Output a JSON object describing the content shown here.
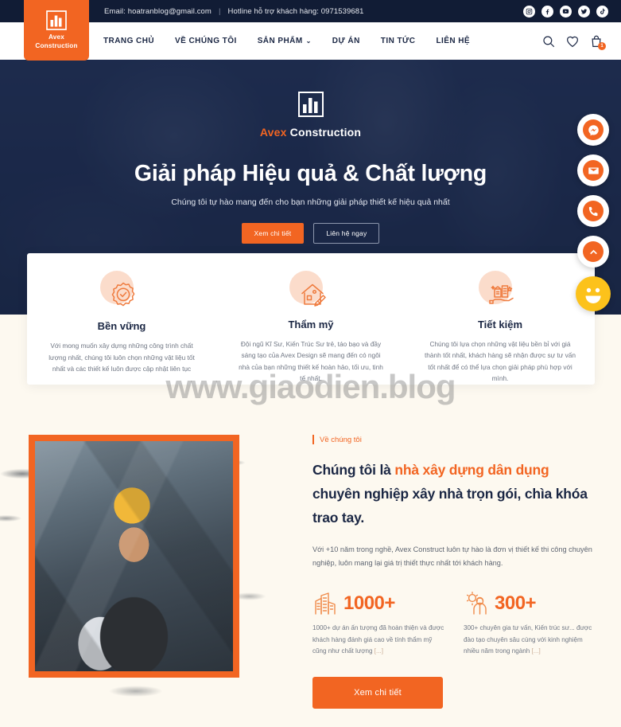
{
  "topbar": {
    "email": "Email: hoatranblog@gmail.com",
    "separator": "|",
    "hotline": "Hotline hỗ trợ khách hàng: 0971539681",
    "socials": [
      {
        "name": "instagram-icon"
      },
      {
        "name": "facebook-icon"
      },
      {
        "name": "youtube-icon"
      },
      {
        "name": "twitter-icon"
      },
      {
        "name": "tiktok-icon"
      }
    ]
  },
  "logo": {
    "line1": "Avex",
    "line2": "Construction",
    "icon": "building-chart-icon",
    "color": "#f26522"
  },
  "nav": {
    "items": [
      {
        "label": "TRANG CHỦ",
        "has_caret": false
      },
      {
        "label": "VỀ CHÚNG TÔI",
        "has_caret": false
      },
      {
        "label": "SẢN PHẨM",
        "has_caret": true,
        "caret": "⌄"
      },
      {
        "label": "DỰ ÁN",
        "has_caret": false
      },
      {
        "label": "TIN TỨC",
        "has_caret": false
      },
      {
        "label": "LIÊN HỆ",
        "has_caret": false
      }
    ],
    "icons": [
      {
        "name": "search-icon"
      },
      {
        "name": "heart-wishlist-icon"
      },
      {
        "name": "shopping-bag-icon",
        "badge": "1"
      }
    ]
  },
  "hero": {
    "brand_first": "Avex",
    "brand_second": " Construction",
    "title": "Giải pháp Hiệu quả & Chất lượng",
    "subtitle": "Chúng tôi tự hào mang đến cho bạn những giải pháp thiết kế hiệu quả nhất",
    "btn_primary": "Xem chi tiết",
    "btn_secondary": "Liên hệ ngay",
    "background_color": "#1e2c4e"
  },
  "features": [
    {
      "icon": "gear-check-icon",
      "title": "Bền vững",
      "desc": "Với mong muốn xây dựng những công trình chất lượng nhất, chúng tôi luôn chọn những vật liệu tốt nhất và các thiết kế luôn được cập nhật liên tục"
    },
    {
      "icon": "house-ruler-icon",
      "title": "Thẩm mỹ",
      "desc": "Đội ngũ Kĩ Sư, Kiến Trúc Sư trẻ, táo bạo và đầy sáng tạo của Avex Design sẽ mang đến có ngôi nhà của bạn những thiết kế hoàn hảo, tối ưu, tinh tế nhất."
    },
    {
      "icon": "hand-saving-icon",
      "title": "Tiết kiệm",
      "desc": "Chúng tôi lựa chọn những vật liệu bền bỉ với giá thành tốt nhất, khách hàng sẽ nhận được sự tư vấn tốt nhất để có thể lựa chọn giải pháp phù hợp với mình."
    }
  ],
  "watermark": "www.giaodien.blog",
  "about": {
    "eyebrow": "Về chúng tôi",
    "heading_part1": "Chúng tôi là ",
    "heading_highlight": "nhà xây dựng dân dụng",
    "heading_part2": " chuyên nghiệp xây nhà trọn gói, chìa khóa trao tay.",
    "paragraph": "Với +10 năm trong nghề, Avex Construct luôn tự hào là đơn vị thiết kế thi công chuyên nghiệp, luôn mang lại giá trị thiết thực nhất tới khách hàng.",
    "cta": "Xem chi tiết",
    "image_alt": "construction-worker-photo",
    "stats": [
      {
        "icon": "buildings-icon",
        "number": "1000+",
        "desc": "1000+ dự án ấn tượng đã hoàn thiện và được khách hàng đánh giá cao về tính thẩm mỹ cũng như chất lượng ",
        "more": "[...]"
      },
      {
        "icon": "engineer-gear-icon",
        "number": "300+",
        "desc": "300+ chuyên gia tư vấn, Kiến trúc sư... được đào tạo chuyên sâu cùng với kinh nghiệm nhiều năm trong ngành ",
        "more": "[...]"
      }
    ]
  },
  "floating_buttons": [
    {
      "name": "messenger-icon"
    },
    {
      "name": "email-icon"
    },
    {
      "name": "phone-icon"
    },
    {
      "name": "scroll-to-top-icon"
    },
    {
      "name": "smiley-chat-icon"
    }
  ],
  "colors": {
    "accent": "#f26522",
    "navy": "#1e2c4e",
    "topbar": "#111c35",
    "cream": "#fdf9f0",
    "yellow": "#fcc21b"
  }
}
